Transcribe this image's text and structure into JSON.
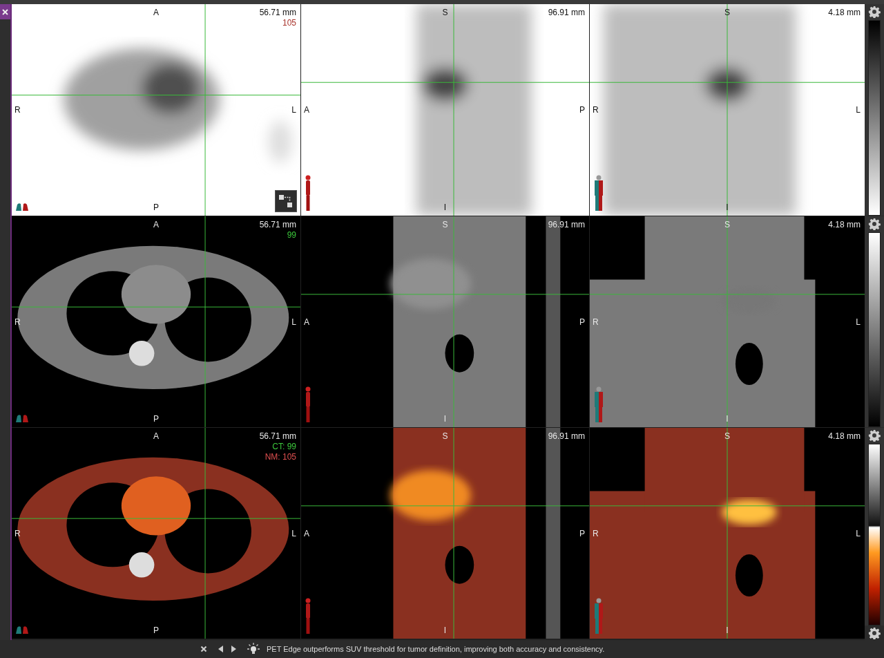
{
  "rows": [
    {
      "kind": "pet",
      "views": [
        {
          "kind": "axial",
          "top": "A",
          "bottom": "P",
          "left": "R",
          "right": "L",
          "distance": "56.71 mm",
          "slice_labels": [
            {
              "text": "105",
              "color": "#a8322a"
            }
          ],
          "layout_button": true
        },
        {
          "kind": "sagittal",
          "top": "S",
          "bottom": "I",
          "left": "A",
          "right": "P",
          "distance": "96.91 mm"
        },
        {
          "kind": "coronal",
          "top": "S",
          "bottom": "I",
          "left": "R",
          "right": "L",
          "distance": "4.18 mm"
        }
      ]
    },
    {
      "kind": "ct",
      "views": [
        {
          "kind": "axial",
          "top": "A",
          "bottom": "P",
          "left": "R",
          "right": "L",
          "distance": "56.71 mm",
          "slice_labels": [
            {
              "text": "99",
              "color": "#3cc83c"
            }
          ]
        },
        {
          "kind": "sagittal",
          "top": "S",
          "bottom": "I",
          "left": "A",
          "right": "P",
          "distance": "96.91 mm"
        },
        {
          "kind": "coronal",
          "top": "S",
          "bottom": "I",
          "left": "R",
          "right": "L",
          "distance": "4.18 mm"
        }
      ]
    },
    {
      "kind": "fusion",
      "views": [
        {
          "kind": "axial",
          "top": "A",
          "bottom": "P",
          "left": "R",
          "right": "L",
          "distance": "56.71 mm",
          "slice_labels": [
            {
              "text": "CT: 99",
              "color": "#3cc83c"
            },
            {
              "text": "NM: 105",
              "color": "#e05050"
            }
          ]
        },
        {
          "kind": "sagittal",
          "top": "S",
          "bottom": "I",
          "left": "A",
          "right": "P",
          "distance": "96.91 mm"
        },
        {
          "kind": "coronal",
          "top": "S",
          "bottom": "I",
          "left": "R",
          "right": "L",
          "distance": "4.18 mm"
        }
      ]
    }
  ],
  "status_bar": {
    "tip": "PET Edge outperforms SUV threshold for tumor definition, improving both accuracy and consistency."
  }
}
